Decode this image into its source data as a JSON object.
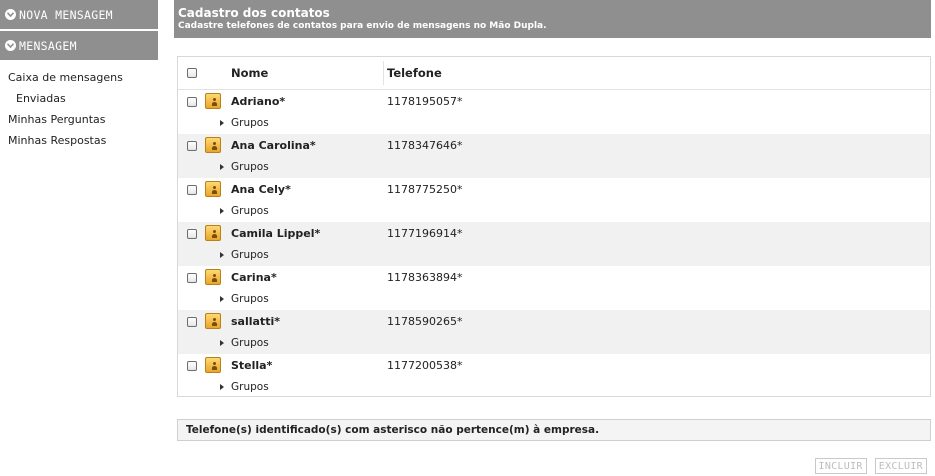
{
  "sidebar": {
    "menus": [
      {
        "label": "NOVA MENSAGEM"
      },
      {
        "label": "MENSAGEM"
      }
    ],
    "links": [
      {
        "label": "Caixa de mensagens"
      },
      {
        "label": "Enviadas"
      },
      {
        "label": "Minhas Perguntas"
      },
      {
        "label": "Minhas Respostas"
      }
    ]
  },
  "header": {
    "title": "Cadastro dos contatos",
    "subtitle": "Cadastre telefones de contatos para envio de mensagens no Mão Dupla."
  },
  "table": {
    "columns": {
      "name": "Nome",
      "phone": "Telefone"
    },
    "rows": [
      {
        "name": "Adriano*",
        "phone": "1178195057*",
        "groups": "Grupos"
      },
      {
        "name": "Ana Carolina*",
        "phone": "1178347646*",
        "groups": "Grupos"
      },
      {
        "name": "Ana Cely*",
        "phone": "1178775250*",
        "groups": "Grupos"
      },
      {
        "name": "Camila Lippel*",
        "phone": "1177196914*",
        "groups": "Grupos"
      },
      {
        "name": "Carina*",
        "phone": "1178363894*",
        "groups": "Grupos"
      },
      {
        "name": "sallatti*",
        "phone": "1178590265*",
        "groups": "Grupos"
      },
      {
        "name": "Stella*",
        "phone": "1177200538*",
        "groups": "Grupos"
      }
    ]
  },
  "notice": "Telefone(s) identificado(s) com asterisco não pertence(m) à empresa.",
  "actions": {
    "include": "INCLUIR",
    "delete": "EXCLUIR"
  },
  "colors": {
    "header_bg": "#8f8f8f",
    "row_alt": "#f1f1f1"
  }
}
